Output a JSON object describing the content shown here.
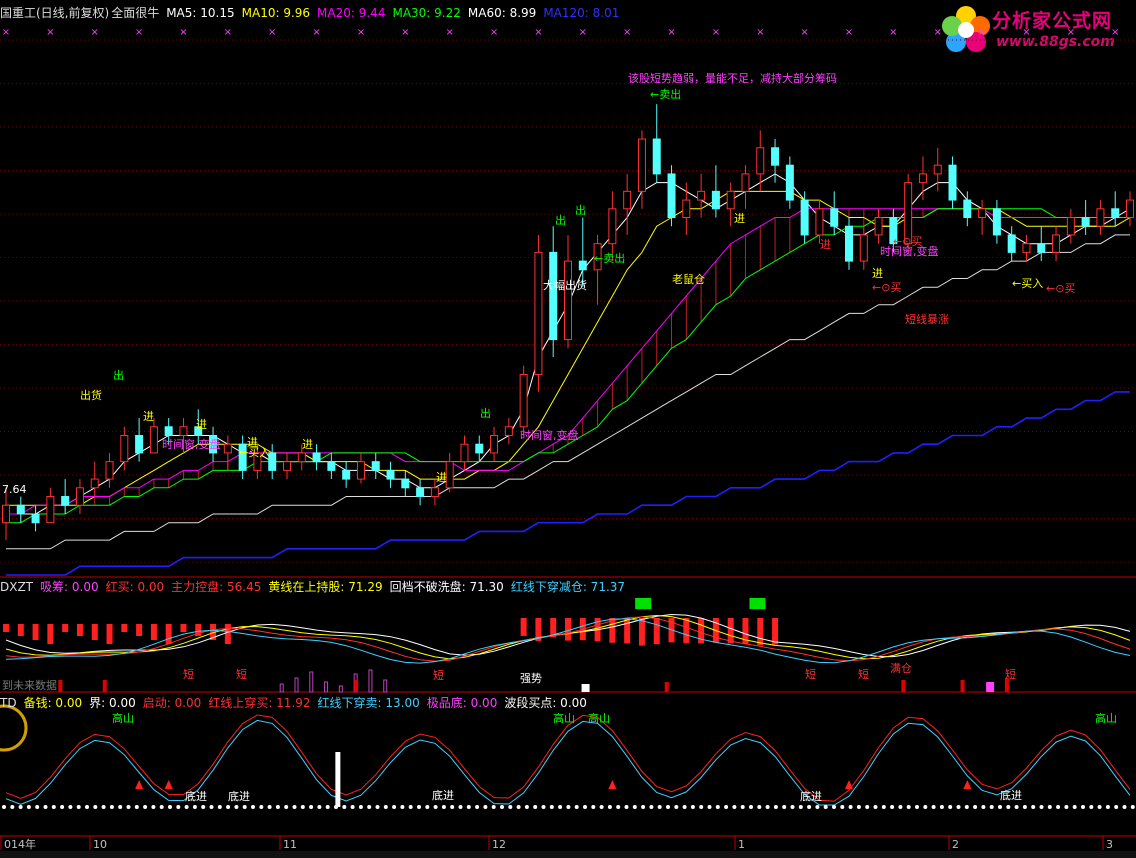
{
  "header": {
    "title": "国重工(日线,前复权)",
    "indicator": "全面很牛",
    "ma": [
      {
        "label": "MA5: 10.15",
        "color": "#ffffff"
      },
      {
        "label": "MA10: 9.96",
        "color": "#ffff00"
      },
      {
        "label": "MA20: 9.44",
        "color": "#ff00ff"
      },
      {
        "label": "MA30: 9.22",
        "color": "#00ff00"
      },
      {
        "label": "MA60: 8.99",
        "color": "#ffffff"
      },
      {
        "label": "MA120: 8.01",
        "color": "#3030ff"
      }
    ]
  },
  "logo": {
    "name": "分析家公式网",
    "url": "www.88gs.com"
  },
  "panel2": {
    "name": "DXZT",
    "items": [
      {
        "label": "吸筹: 0.00",
        "color": "#ff40ff"
      },
      {
        "label": "红买: 0.00",
        "color": "#ff3030"
      },
      {
        "label": "主力控盘: 56.45",
        "color": "#ff3030"
      },
      {
        "label": "黄线在上持股: 71.29",
        "color": "#ffff00"
      },
      {
        "label": "回档不破洗盘: 71.30",
        "color": "#ffffff"
      },
      {
        "label": "红线下穿减仓: 71.37",
        "color": "#40d0ff"
      }
    ],
    "future_note": "到未来数据"
  },
  "panel3": {
    "name": "TD",
    "items": [
      {
        "label": "备钱: 0.00",
        "color": "#ffff00"
      },
      {
        "label": "界: 0.00",
        "color": "#ffffff"
      },
      {
        "label": "启动: 0.00",
        "color": "#ff3030"
      },
      {
        "label": "红线上穿买: 11.92",
        "color": "#ff3030"
      },
      {
        "label": "红线下穿卖: 13.00",
        "color": "#40d0ff"
      },
      {
        "label": "极品底: 0.00",
        "color": "#ff40ff"
      },
      {
        "label": "波段买点: 0.00",
        "color": "#ffffff"
      }
    ]
  },
  "x_axis": [
    "014年",
    "10",
    "11",
    "12",
    "1",
    "2",
    "3"
  ],
  "annotations": {
    "main": [
      {
        "text": "该股短势趋弱，量能不足，减持大部分筹码",
        "color": "#ff40ff"
      },
      {
        "text": "←卖出",
        "color": "#00ff00"
      },
      {
        "text": "出",
        "color": "#00ff00"
      },
      {
        "text": "出",
        "color": "#00ff00"
      },
      {
        "text": "大幅出货",
        "color": "#ffffff"
      },
      {
        "text": "←卖出",
        "color": "#00ff00"
      },
      {
        "text": "老鼠仓",
        "color": "#ffff00"
      },
      {
        "text": "进",
        "color": "#ffff00"
      },
      {
        "text": "进",
        "color": "#ff3030"
      },
      {
        "text": "进",
        "color": "#ffff00"
      },
      {
        "text": "←⊙买",
        "color": "#ff3030"
      },
      {
        "text": "时间窗,变盘",
        "color": "#ff40ff"
      },
      {
        "text": "←⊙买",
        "color": "#ff3030"
      },
      {
        "text": "短线暴涨",
        "color": "#ff3030"
      },
      {
        "text": "←买入",
        "color": "#ffff00"
      },
      {
        "text": "←⊙买",
        "color": "#ff3030"
      },
      {
        "text": "出",
        "color": "#00ff00"
      },
      {
        "text": "时间窗,变盘",
        "color": "#ff40ff"
      },
      {
        "text": "出",
        "color": "#00ff00"
      },
      {
        "text": "出货",
        "color": "#ffff00"
      },
      {
        "text": "进",
        "color": "#ffff00"
      },
      {
        "text": "时间窗,变盘",
        "color": "#ff40ff"
      },
      {
        "text": "进",
        "color": "#ffff00"
      },
      {
        "text": "←买入",
        "color": "#ffff00"
      },
      {
        "text": "进",
        "color": "#ffff00"
      },
      {
        "text": "进",
        "color": "#ffff00"
      },
      {
        "text": "进",
        "color": "#ffff00"
      },
      {
        "text": "7.64",
        "color": "#ffffff"
      }
    ],
    "panel2": [
      {
        "text": "短",
        "color": "#ff3030"
      },
      {
        "text": "短",
        "color": "#ff3030"
      },
      {
        "text": "短",
        "color": "#ff3030"
      },
      {
        "text": "强势",
        "color": "#ffffff"
      },
      {
        "text": "短",
        "color": "#ff3030"
      },
      {
        "text": "短",
        "color": "#ff3030"
      },
      {
        "text": "满仓",
        "color": "#ff3030"
      },
      {
        "text": "短",
        "color": "#ff3030"
      }
    ],
    "panel3": [
      {
        "text": "底进",
        "color": "#ffffff"
      },
      {
        "text": "底进",
        "color": "#ffffff"
      },
      {
        "text": "底进",
        "color": "#ffffff"
      },
      {
        "text": "底进",
        "color": "#ffffff"
      },
      {
        "text": "底进",
        "color": "#ffffff"
      },
      {
        "text": "高山",
        "color": "#00ff00"
      },
      {
        "text": "高山",
        "color": "#00ff00"
      },
      {
        "text": "高山",
        "color": "#00ff00"
      },
      {
        "text": "高山",
        "color": "#00ff00"
      }
    ]
  },
  "bottom_tabs": [],
  "chart_data": {
    "type": "line",
    "title": "国重工(日线,前复权)",
    "xlabel": "",
    "ylabel": "",
    "x_ticks": [
      "014年",
      "10",
      "11",
      "12",
      "1",
      "2",
      "3"
    ],
    "ylim": [
      6.9,
      12.6
    ],
    "candles": [
      [
        7.5,
        7.9,
        7.3,
        7.7
      ],
      [
        7.7,
        7.8,
        7.5,
        7.6
      ],
      [
        7.6,
        7.7,
        7.4,
        7.5
      ],
      [
        7.5,
        7.9,
        7.5,
        7.8
      ],
      [
        7.8,
        8.0,
        7.6,
        7.7
      ],
      [
        7.7,
        8.0,
        7.6,
        7.9
      ],
      [
        7.9,
        8.2,
        7.8,
        8.0
      ],
      [
        8.0,
        8.3,
        7.9,
        8.2
      ],
      [
        8.2,
        8.6,
        8.1,
        8.5
      ],
      [
        8.5,
        8.7,
        8.2,
        8.3
      ],
      [
        8.3,
        8.7,
        8.3,
        8.6
      ],
      [
        8.6,
        8.7,
        8.4,
        8.5
      ],
      [
        8.5,
        8.7,
        8.3,
        8.6
      ],
      [
        8.6,
        8.8,
        8.4,
        8.5
      ],
      [
        8.5,
        8.6,
        8.2,
        8.3
      ],
      [
        8.3,
        8.5,
        8.1,
        8.4
      ],
      [
        8.4,
        8.5,
        8.0,
        8.1
      ],
      [
        8.1,
        8.4,
        8.0,
        8.3
      ],
      [
        8.3,
        8.4,
        8.0,
        8.1
      ],
      [
        8.1,
        8.3,
        8.0,
        8.2
      ],
      [
        8.2,
        8.4,
        8.1,
        8.3
      ],
      [
        8.3,
        8.4,
        8.1,
        8.2
      ],
      [
        8.2,
        8.3,
        8.0,
        8.1
      ],
      [
        8.1,
        8.2,
        7.9,
        8.0
      ],
      [
        8.0,
        8.3,
        7.95,
        8.2
      ],
      [
        8.2,
        8.3,
        8.0,
        8.1
      ],
      [
        8.1,
        8.2,
        7.9,
        8.0
      ],
      [
        8.0,
        8.1,
        7.8,
        7.9
      ],
      [
        7.9,
        8.0,
        7.7,
        7.8
      ],
      [
        7.8,
        8.0,
        7.7,
        7.9
      ],
      [
        7.9,
        8.3,
        7.85,
        8.2
      ],
      [
        8.2,
        8.5,
        8.1,
        8.4
      ],
      [
        8.4,
        8.5,
        8.2,
        8.3
      ],
      [
        8.3,
        8.6,
        8.2,
        8.5
      ],
      [
        8.5,
        8.7,
        8.4,
        8.6
      ],
      [
        8.6,
        9.3,
        8.5,
        9.2
      ],
      [
        9.2,
        10.8,
        9.0,
        10.6
      ],
      [
        10.6,
        10.9,
        9.4,
        9.6
      ],
      [
        9.6,
        10.8,
        9.5,
        10.5
      ],
      [
        10.5,
        11.0,
        10.2,
        10.4
      ],
      [
        10.4,
        10.8,
        10.0,
        10.7
      ],
      [
        10.7,
        11.3,
        10.5,
        11.1
      ],
      [
        11.1,
        11.5,
        10.8,
        11.3
      ],
      [
        11.3,
        12.0,
        11.1,
        11.9
      ],
      [
        11.9,
        12.3,
        11.4,
        11.5
      ],
      [
        11.5,
        11.6,
        10.9,
        11.0
      ],
      [
        11.0,
        11.4,
        10.8,
        11.2
      ],
      [
        11.2,
        11.5,
        11.0,
        11.3
      ],
      [
        11.3,
        11.6,
        11.0,
        11.1
      ],
      [
        11.1,
        11.4,
        10.9,
        11.3
      ],
      [
        11.3,
        11.6,
        11.1,
        11.5
      ],
      [
        11.5,
        12.0,
        11.3,
        11.8
      ],
      [
        11.8,
        11.9,
        11.4,
        11.6
      ],
      [
        11.6,
        11.7,
        11.1,
        11.2
      ],
      [
        11.2,
        11.3,
        10.7,
        10.8
      ],
      [
        10.8,
        11.2,
        10.7,
        11.1
      ],
      [
        11.1,
        11.3,
        10.8,
        10.9
      ],
      [
        10.9,
        11.0,
        10.4,
        10.5
      ],
      [
        10.5,
        10.9,
        10.4,
        10.8
      ],
      [
        10.8,
        11.1,
        10.7,
        11.0
      ],
      [
        11.0,
        11.1,
        10.6,
        10.7
      ],
      [
        10.7,
        11.5,
        10.6,
        11.4
      ],
      [
        11.4,
        11.7,
        11.2,
        11.5
      ],
      [
        11.5,
        11.8,
        11.3,
        11.6
      ],
      [
        11.6,
        11.7,
        11.1,
        11.2
      ],
      [
        11.2,
        11.3,
        10.9,
        11.0
      ],
      [
        11.0,
        11.2,
        10.8,
        11.1
      ],
      [
        11.1,
        11.2,
        10.7,
        10.8
      ],
      [
        10.8,
        10.9,
        10.5,
        10.6
      ],
      [
        10.6,
        10.8,
        10.5,
        10.7
      ],
      [
        10.7,
        10.9,
        10.5,
        10.6
      ],
      [
        10.6,
        10.9,
        10.5,
        10.8
      ],
      [
        10.8,
        11.1,
        10.7,
        11.0
      ],
      [
        11.0,
        11.2,
        10.8,
        10.9
      ],
      [
        10.9,
        11.2,
        10.8,
        11.1
      ],
      [
        11.1,
        11.3,
        10.9,
        11.0
      ],
      [
        11.0,
        11.3,
        10.9,
        11.2
      ]
    ],
    "series": [
      {
        "name": "MA5",
        "values": [
          7.6,
          7.6,
          7.6,
          7.7,
          7.7,
          7.8,
          7.9,
          8.0,
          8.2,
          8.3,
          8.4,
          8.5,
          8.5,
          8.5,
          8.5,
          8.4,
          8.3,
          8.3,
          8.2,
          8.2,
          8.2,
          8.2,
          8.2,
          8.1,
          8.1,
          8.1,
          8.0,
          8.0,
          7.9,
          7.9,
          8.0,
          8.1,
          8.2,
          8.4,
          8.5,
          8.8,
          9.4,
          9.7,
          10.0,
          10.4,
          10.6,
          10.8,
          11.0,
          11.3,
          11.4,
          11.4,
          11.3,
          11.2,
          11.1,
          11.2,
          11.3,
          11.4,
          11.5,
          11.4,
          11.2,
          11.0,
          10.9,
          10.8,
          10.8,
          10.9,
          10.9,
          11.1,
          11.3,
          11.4,
          11.4,
          11.2,
          11.1,
          10.9,
          10.8,
          10.7,
          10.7,
          10.7,
          10.8,
          10.9,
          10.9,
          11.0,
          11.1
        ]
      },
      {
        "name": "MA10",
        "values": [
          7.7,
          7.7,
          7.7,
          7.7,
          7.7,
          7.7,
          7.8,
          7.8,
          7.9,
          8.0,
          8.1,
          8.2,
          8.3,
          8.4,
          8.4,
          8.4,
          8.4,
          8.4,
          8.3,
          8.3,
          8.3,
          8.2,
          8.2,
          8.2,
          8.2,
          8.1,
          8.1,
          8.1,
          8.0,
          8.0,
          8.0,
          8.0,
          8.1,
          8.1,
          8.2,
          8.4,
          8.6,
          8.9,
          9.2,
          9.5,
          9.8,
          10.1,
          10.4,
          10.6,
          10.9,
          11.0,
          11.1,
          11.1,
          11.2,
          11.3,
          11.3,
          11.3,
          11.3,
          11.3,
          11.2,
          11.2,
          11.1,
          11.0,
          11.0,
          10.9,
          10.9,
          11.0,
          11.0,
          11.1,
          11.1,
          11.1,
          11.1,
          11.1,
          11.0,
          10.9,
          10.9,
          10.9,
          10.9,
          10.9,
          10.9,
          10.9,
          11.0
        ]
      },
      {
        "name": "MA20",
        "values": [
          7.6,
          7.6,
          7.7,
          7.7,
          7.7,
          7.8,
          7.8,
          7.8,
          7.9,
          7.9,
          8.0,
          8.0,
          8.1,
          8.1,
          8.2,
          8.2,
          8.3,
          8.3,
          8.3,
          8.3,
          8.3,
          8.3,
          8.3,
          8.3,
          8.3,
          8.3,
          8.3,
          8.2,
          8.2,
          8.2,
          8.2,
          8.1,
          8.1,
          8.1,
          8.1,
          8.2,
          8.3,
          8.4,
          8.5,
          8.7,
          8.9,
          9.1,
          9.3,
          9.5,
          9.7,
          9.9,
          10.1,
          10.3,
          10.5,
          10.7,
          10.8,
          10.9,
          11.0,
          11.0,
          11.1,
          11.1,
          11.1,
          11.1,
          11.1,
          11.1,
          11.1,
          11.1,
          11.1,
          11.1,
          11.1,
          11.1,
          11.1,
          11.0,
          11.0,
          11.0,
          11.0,
          11.0,
          11.0,
          11.0,
          11.0,
          11.0,
          11.0
        ]
      },
      {
        "name": "MA30",
        "values": [
          7.5,
          7.5,
          7.6,
          7.6,
          7.6,
          7.7,
          7.7,
          7.7,
          7.8,
          7.8,
          7.9,
          7.9,
          8.0,
          8.0,
          8.1,
          8.1,
          8.1,
          8.2,
          8.2,
          8.2,
          8.2,
          8.2,
          8.3,
          8.3,
          8.3,
          8.3,
          8.3,
          8.3,
          8.2,
          8.2,
          8.2,
          8.2,
          8.2,
          8.2,
          8.2,
          8.2,
          8.3,
          8.3,
          8.4,
          8.5,
          8.6,
          8.8,
          8.9,
          9.1,
          9.3,
          9.5,
          9.6,
          9.8,
          10.0,
          10.1,
          10.3,
          10.4,
          10.5,
          10.6,
          10.7,
          10.8,
          10.8,
          10.9,
          10.9,
          11.0,
          11.0,
          11.0,
          11.0,
          11.1,
          11.1,
          11.1,
          11.1,
          11.1,
          11.1,
          11.1,
          11.1,
          11.0,
          11.0,
          11.0,
          11.0,
          11.0,
          11.0
        ]
      },
      {
        "name": "MA60",
        "values": [
          7.2,
          7.2,
          7.2,
          7.2,
          7.3,
          7.3,
          7.3,
          7.3,
          7.4,
          7.4,
          7.4,
          7.5,
          7.5,
          7.5,
          7.6,
          7.6,
          7.6,
          7.6,
          7.7,
          7.7,
          7.7,
          7.7,
          7.7,
          7.8,
          7.8,
          7.8,
          7.8,
          7.8,
          7.8,
          7.8,
          7.9,
          7.9,
          7.9,
          7.9,
          8.0,
          8.0,
          8.1,
          8.2,
          8.2,
          8.3,
          8.4,
          8.5,
          8.6,
          8.7,
          8.8,
          8.9,
          9.0,
          9.1,
          9.2,
          9.2,
          9.3,
          9.4,
          9.5,
          9.6,
          9.6,
          9.7,
          9.8,
          9.9,
          9.9,
          10.0,
          10.0,
          10.1,
          10.2,
          10.2,
          10.3,
          10.3,
          10.4,
          10.4,
          10.5,
          10.5,
          10.6,
          10.6,
          10.6,
          10.7,
          10.7,
          10.8,
          10.8
        ]
      },
      {
        "name": "MA120",
        "values": [
          6.9,
          6.9,
          6.9,
          6.9,
          6.9,
          7.0,
          7.0,
          7.0,
          7.0,
          7.0,
          7.0,
          7.0,
          7.1,
          7.1,
          7.1,
          7.1,
          7.1,
          7.1,
          7.1,
          7.2,
          7.2,
          7.2,
          7.2,
          7.2,
          7.2,
          7.2,
          7.3,
          7.3,
          7.3,
          7.3,
          7.3,
          7.3,
          7.4,
          7.4,
          7.4,
          7.4,
          7.5,
          7.5,
          7.5,
          7.5,
          7.6,
          7.6,
          7.6,
          7.7,
          7.7,
          7.7,
          7.8,
          7.8,
          7.8,
          7.9,
          7.9,
          7.9,
          8.0,
          8.0,
          8.0,
          8.1,
          8.1,
          8.2,
          8.2,
          8.2,
          8.3,
          8.3,
          8.4,
          8.4,
          8.5,
          8.5,
          8.5,
          8.6,
          8.6,
          8.7,
          8.7,
          8.8,
          8.8,
          8.9,
          8.9,
          9.0,
          9.0
        ]
      }
    ]
  }
}
